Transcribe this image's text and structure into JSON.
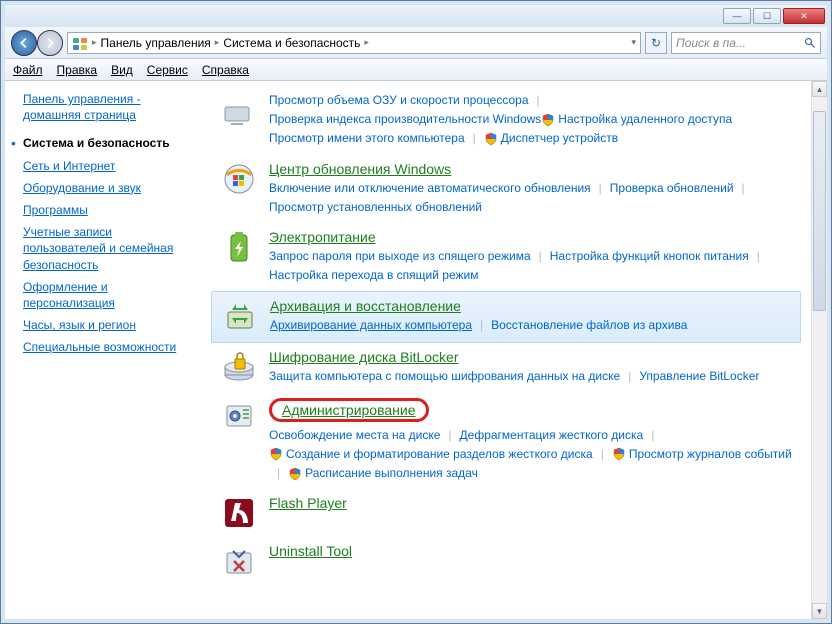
{
  "window": {
    "min_title": "—",
    "max_title": "☐",
    "close_title": "✕"
  },
  "breadcrumb": {
    "root": "Панель управления",
    "section": "Система и безопасность"
  },
  "search": {
    "placeholder": "Поиск в па..."
  },
  "refresh": "↻",
  "menu": {
    "file": "Файл",
    "edit": "Правка",
    "view": "Вид",
    "tools": "Сервис",
    "help": "Справка"
  },
  "sidebar": {
    "home": "Панель управления - домашняя страница",
    "items": [
      {
        "label": "Система и безопасность",
        "active": true
      },
      {
        "label": "Сеть и Интернет"
      },
      {
        "label": "Оборудование и звук"
      },
      {
        "label": "Программы"
      },
      {
        "label": "Учетные записи пользователей и семейная безопасность"
      },
      {
        "label": "Оформление и персонализация"
      },
      {
        "label": "Часы, язык и регион"
      },
      {
        "label": "Специальные возможности"
      }
    ]
  },
  "sections": {
    "partial": {
      "links": [
        {
          "label": "Просмотр объема ОЗУ и скорости процессора"
        },
        {
          "label": "Проверка индекса производительности Windows"
        },
        {
          "label": "Настройка удаленного доступа",
          "shield": true
        },
        {
          "label": "Просмотр имени этого компьютера"
        },
        {
          "label": "Диспетчер устройств",
          "shield": true
        }
      ]
    },
    "update": {
      "title": "Центр обновления Windows",
      "links": [
        {
          "label": "Включение или отключение автоматического обновления"
        },
        {
          "label": "Проверка обновлений"
        },
        {
          "label": "Просмотр установленных обновлений"
        }
      ]
    },
    "power": {
      "title": "Электропитание",
      "links": [
        {
          "label": "Запрос пароля при выходе из спящего режима"
        },
        {
          "label": "Настройка функций кнопок питания"
        },
        {
          "label": "Настройка перехода в спящий режим"
        }
      ]
    },
    "backup": {
      "title": "Архивация и восстановление",
      "links": [
        {
          "label": "Архивирование данных компьютера",
          "underline": true
        },
        {
          "label": "Восстановление файлов из архива"
        }
      ]
    },
    "bitlocker": {
      "title": "Шифрование диска BitLocker",
      "links": [
        {
          "label": "Защита компьютера с помощью шифрования данных на диске"
        },
        {
          "label": "Управление BitLocker"
        }
      ]
    },
    "admin": {
      "title": "Администрирование",
      "links": [
        {
          "label": "Освобождение места на диске"
        },
        {
          "label": "Дефрагментация жесткого диска"
        },
        {
          "label": "Создание и форматирование разделов жесткого диска",
          "shield": true
        },
        {
          "label": "Просмотр журналов событий",
          "shield": true
        },
        {
          "label": "Расписание выполнения задач",
          "shield": true
        }
      ]
    },
    "flash": {
      "title": "Flash Player"
    },
    "uninstall": {
      "title": "Uninstall Tool"
    }
  }
}
